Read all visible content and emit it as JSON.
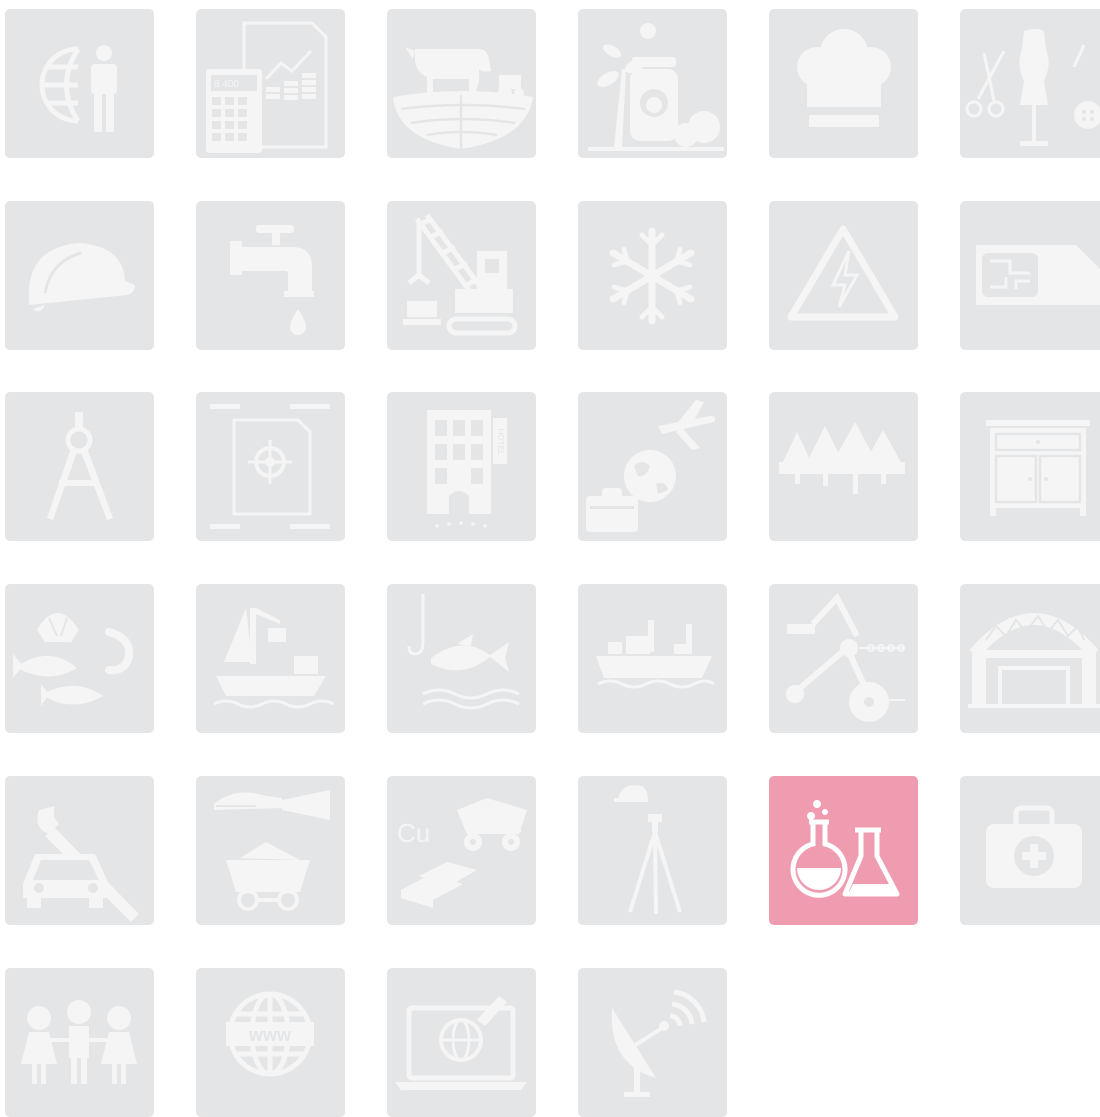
{
  "colors": {
    "tile_background": "#e4e5e7",
    "icon_fill": "#f5f5f5",
    "selected_background": "#ef9bb0",
    "page_background": "#ffffff"
  },
  "selected_tile": "chemistry-lab-icon",
  "tiles": [
    {
      "icon": "globe-person-icon"
    },
    {
      "icon": "finance-calculator-icon",
      "text": "8.400"
    },
    {
      "icon": "agriculture-cow-icon"
    },
    {
      "icon": "food-preserves-icon"
    },
    {
      "icon": "chef-hat-icon"
    },
    {
      "icon": "tailoring-icon"
    },
    {
      "icon": "hard-hat-icon"
    },
    {
      "icon": "water-tap-icon"
    },
    {
      "icon": "crane-icon"
    },
    {
      "icon": "snowflake-icon"
    },
    {
      "icon": "high-voltage-icon"
    },
    {
      "icon": "sim-card-icon"
    },
    {
      "icon": "drafting-compass-icon"
    },
    {
      "icon": "blueprint-target-icon"
    },
    {
      "icon": "hotel-icon",
      "text": "HOTEL"
    },
    {
      "icon": "travel-icon"
    },
    {
      "icon": "forest-icon"
    },
    {
      "icon": "cabinet-icon"
    },
    {
      "icon": "seafood-icon"
    },
    {
      "icon": "port-cargo-icon"
    },
    {
      "icon": "fishing-icon"
    },
    {
      "icon": "ship-icon"
    },
    {
      "icon": "machinery-icon"
    },
    {
      "icon": "hangar-icon"
    },
    {
      "icon": "car-repair-icon"
    },
    {
      "icon": "mining-cart-icon"
    },
    {
      "icon": "copper-mining-icon",
      "text": "Cu"
    },
    {
      "icon": "surveying-icon"
    },
    {
      "icon": "chemistry-lab-icon"
    },
    {
      "icon": "first-aid-icon"
    },
    {
      "icon": "children-icon"
    },
    {
      "icon": "www-globe-icon",
      "text": "www"
    },
    {
      "icon": "laptop-globe-icon"
    },
    {
      "icon": "satellite-dish-icon"
    }
  ]
}
